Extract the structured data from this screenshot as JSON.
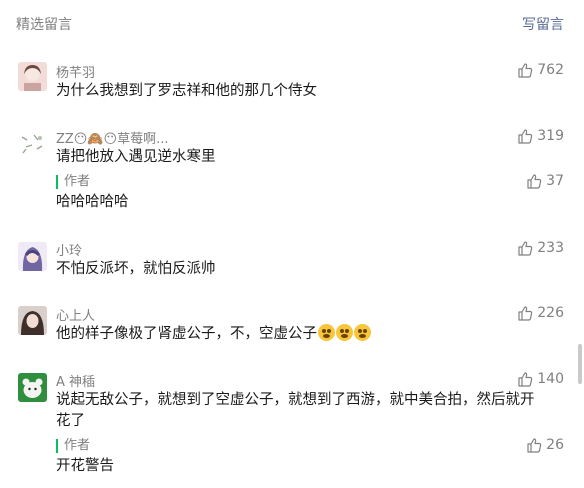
{
  "header": {
    "title": "精选留言",
    "action": "写留言"
  },
  "comments": [
    {
      "name": "杨芊羽",
      "text": "为什么我想到了罗志祥和他的那几个侍女",
      "likes": "762",
      "avatar_color": "#e8c9c5"
    },
    {
      "name": "ZZ😶🙈😶草莓啊...",
      "text": "请把他放入遇见逆水寒里",
      "likes": "319",
      "avatar_color": "#dfe6d9",
      "reply": {
        "label": "作者",
        "text": "哈哈哈哈哈",
        "likes": "37"
      }
    },
    {
      "name": "小玲",
      "text": "不怕反派坏，就怕反派帅",
      "likes": "233",
      "avatar_color": "#8b83b6"
    },
    {
      "name": "心上人",
      "text": "他的样子像极了肾虚公子，不，空虚公子",
      "likes": "226",
      "avatar_color": "#6e5a55"
    },
    {
      "name": "A 神䅤",
      "text_line1": "说起无敌公子，就想到了空虚公子，就想到了西游，就中美合拍，然后就开",
      "text_line2": "花了",
      "likes": "140",
      "avatar_color": "#2f8f3f",
      "reply": {
        "label": "作者",
        "text": "开花警告",
        "likes": "26"
      }
    }
  ],
  "colors": {
    "accent_green": "#07c160",
    "link_blue": "#576b95",
    "gray": "#808080"
  },
  "icons": [
    "thumb-up-icon",
    "grin-emoji-icon"
  ]
}
